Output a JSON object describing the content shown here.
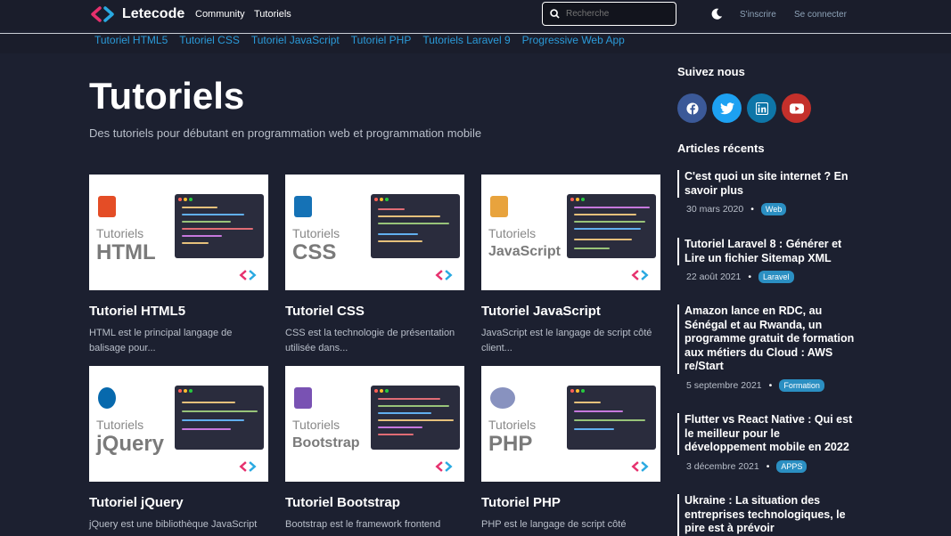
{
  "header": {
    "brand": "Letecode",
    "nav": [
      "Community",
      "Tutoriels"
    ],
    "search_placeholder": "Recherche",
    "signup": "S'inscrire",
    "login": "Se connecter"
  },
  "subnav": [
    "Tutoriel HTML5",
    "Tutoriel CSS",
    "Tutoriel JavaScript",
    "Tutoriel PHP",
    "Tutoriels Laravel 9",
    "Progressive Web App"
  ],
  "main": {
    "title": "Tutoriels",
    "subtitle": "Des tutoriels pour débutant en programmation web et programmation mobile",
    "cards": [
      {
        "thumb_label": "Tutoriels",
        "thumb_name": "HTML",
        "badge_text": "HTML",
        "badge_color": "#e44d26",
        "title": "Tutoriel HTML5",
        "desc1": "HTML est le principal langage de",
        "desc2": "balisage pour..."
      },
      {
        "thumb_label": "Tutoriels",
        "thumb_name": "CSS",
        "badge_text": "CSS",
        "badge_color": "#1572b6",
        "title": "Tutoriel CSS",
        "desc1": "CSS est la technologie de présentation",
        "desc2": "utilisée dans..."
      },
      {
        "thumb_label": "Tutoriels",
        "thumb_name": "JavaScript",
        "badge_text": "JS",
        "badge_color": "#e8a33d",
        "title": "Tutoriel JavaScript",
        "desc1": "JavaScript est le langage de script côté",
        "desc2": "client..."
      },
      {
        "thumb_label": "Tutoriels",
        "thumb_name": "jQuery",
        "badge_text": "jQuery",
        "badge_color": "#0769ad",
        "title": "Tutoriel jQuery",
        "desc1": "jQuery est une bibliothèque JavaScript",
        "desc2": ""
      },
      {
        "thumb_label": "Tutoriels",
        "thumb_name": "Bootstrap",
        "badge_text": "B",
        "badge_color": "#7952b3",
        "title": "Tutoriel Bootstrap",
        "desc1": "Bootstrap est le framework frontend",
        "desc2": ""
      },
      {
        "thumb_label": "Tutoriels",
        "thumb_name": "PHP",
        "badge_text": "php",
        "badge_color": "#8892bf",
        "title": "Tutoriel PHP",
        "desc1": "PHP est le langage de script côté",
        "desc2": ""
      }
    ]
  },
  "sidebar": {
    "follow_title": "Suivez nous",
    "social": [
      {
        "name": "facebook",
        "color": "#3b5998"
      },
      {
        "name": "twitter",
        "color": "#1da1f2"
      },
      {
        "name": "linkedin",
        "color": "#0e76a8"
      },
      {
        "name": "youtube",
        "color": "#c4302b"
      }
    ],
    "recent_title": "Articles récents",
    "articles": [
      {
        "title": "C'est quoi un site internet ? En savoir plus",
        "date": "30 mars 2020",
        "tag": "Web"
      },
      {
        "title": "Tutoriel Laravel 8 : Générer et Lire un fichier Sitemap XML",
        "date": "22 août 2021",
        "tag": "Laravel"
      },
      {
        "title": "Amazon lance en RDC, au Sénégal et au Rwanda, un programme gratuit de formation aux métiers du Cloud : AWS re/Start",
        "date": "5 septembre 2021",
        "tag": "Formation"
      },
      {
        "title": "Flutter vs React Native : Qui est le meilleur pour le développement mobile en 2022",
        "date": "3 décembre 2021",
        "tag": "APPS"
      },
      {
        "title": "Ukraine : La situation des entreprises technologiques, le pire est à prévoir",
        "date": "",
        "tag": ""
      }
    ]
  }
}
